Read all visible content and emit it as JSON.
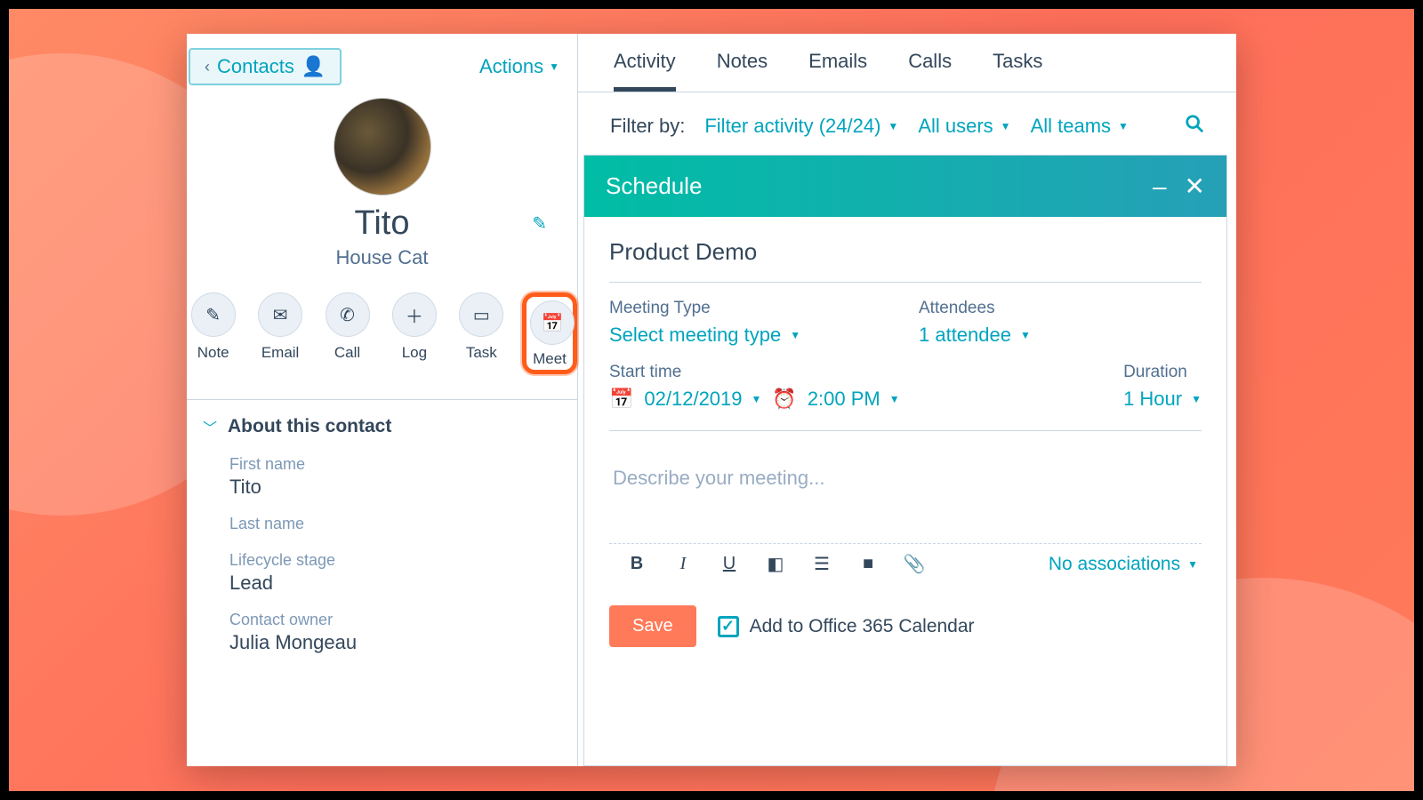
{
  "back": {
    "label": "Contacts",
    "arrow": "‹"
  },
  "actions_label": "Actions",
  "contact": {
    "name": "Tito",
    "subtitle": "House Cat"
  },
  "action_buttons": [
    {
      "key": "note",
      "label": "Note",
      "icon": "✎"
    },
    {
      "key": "email",
      "label": "Email",
      "icon": "✉"
    },
    {
      "key": "call",
      "label": "Call",
      "icon": "✆"
    },
    {
      "key": "log",
      "label": "Log",
      "icon": "＋"
    },
    {
      "key": "task",
      "label": "Task",
      "icon": "▭"
    },
    {
      "key": "meet",
      "label": "Meet",
      "icon": "📅"
    }
  ],
  "about_section_title": "About this contact",
  "fields": {
    "first_name": {
      "label": "First name",
      "value": "Tito"
    },
    "last_name": {
      "label": "Last name",
      "value": ""
    },
    "lifecycle": {
      "label": "Lifecycle stage",
      "value": "Lead"
    },
    "owner": {
      "label": "Contact owner",
      "value": "Julia Mongeau"
    }
  },
  "tabs": [
    "Activity",
    "Notes",
    "Emails",
    "Calls",
    "Tasks"
  ],
  "active_tab": "Activity",
  "filters": {
    "prefix": "Filter by:",
    "activity": "Filter activity (24/24)",
    "users": "All users",
    "teams": "All teams"
  },
  "schedule_panel": {
    "header": "Schedule",
    "title": "Product Demo",
    "meeting_type_label": "Meeting Type",
    "meeting_type_value": "Select meeting type",
    "attendees_label": "Attendees",
    "attendees_value": "1 attendee",
    "start_label": "Start time",
    "start_date": "02/12/2019",
    "start_time": "2:00 PM",
    "duration_label": "Duration",
    "duration_value": "1 Hour",
    "description_placeholder": "Describe your meeting...",
    "associations_label": "No associations",
    "save_label": "Save",
    "add_calendar_label": "Add to Office 365 Calendar",
    "add_calendar_checked": true
  }
}
